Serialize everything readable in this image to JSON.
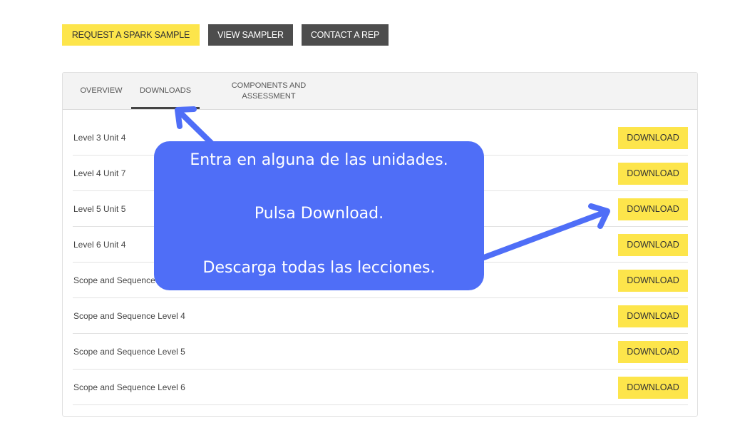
{
  "top_buttons": {
    "request_sample": "REQUEST A SPARK SAMPLE",
    "view_sampler": "VIEW SAMPLER",
    "contact_rep": "CONTACT A REP"
  },
  "tabs": [
    {
      "label": "OVERVIEW"
    },
    {
      "label": "DOWNLOADS"
    },
    {
      "label": "COMPONENTS AND ASSESSMENT"
    }
  ],
  "downloads": [
    {
      "label": "Level 3 Unit 4",
      "button": "DOWNLOAD"
    },
    {
      "label": "Level 4 Unit 7",
      "button": "DOWNLOAD"
    },
    {
      "label": "Level 5 Unit 5",
      "button": "DOWNLOAD"
    },
    {
      "label": "Level 6 Unit 4",
      "button": "DOWNLOAD"
    },
    {
      "label": "Scope and Sequence",
      "button": "DOWNLOAD"
    },
    {
      "label": "Scope and Sequence Level 4",
      "button": "DOWNLOAD"
    },
    {
      "label": "Scope and Sequence Level 5",
      "button": "DOWNLOAD"
    },
    {
      "label": "Scope and Sequence Level 6",
      "button": "DOWNLOAD"
    }
  ],
  "annotation": {
    "line1": "Entra en alguna de las unidades.",
    "line2": "Pulsa Download.",
    "line3": "Descarga todas las lecciones."
  },
  "colors": {
    "accent_yellow": "#fde54b",
    "dark_button": "#4d4d4d",
    "annotation_blue": "#4f6ef7"
  }
}
